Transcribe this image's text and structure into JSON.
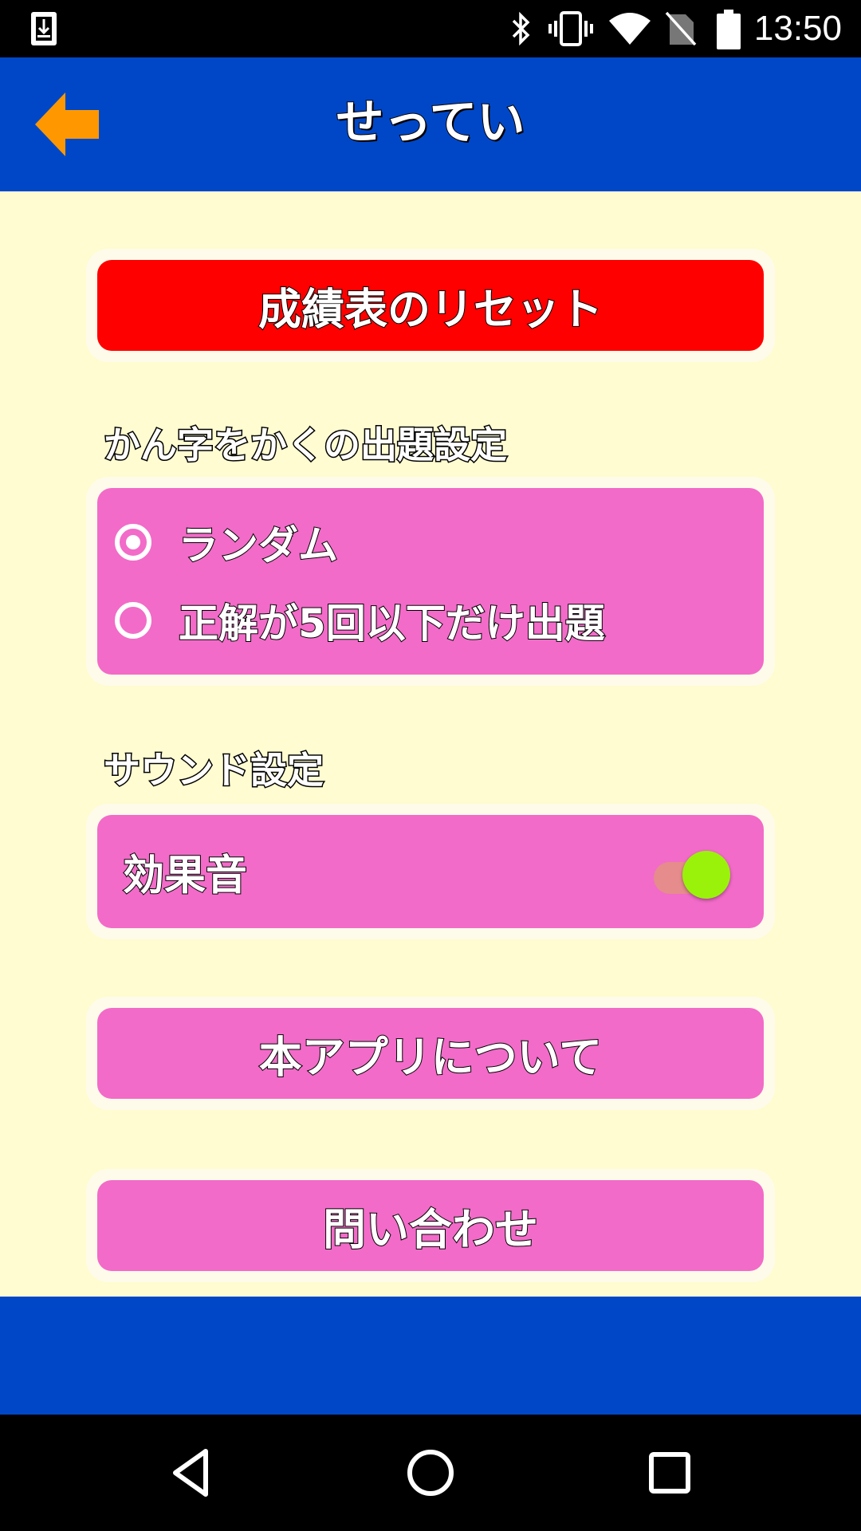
{
  "status_bar": {
    "time": "13:50",
    "icons": [
      "download-icon",
      "bluetooth-icon",
      "vibrate-icon",
      "wifi-icon",
      "no-sim-icon",
      "battery-icon"
    ]
  },
  "app_bar": {
    "title": "せってい",
    "back_icon": "back-arrow-icon"
  },
  "reset_button": {
    "label": "成績表のリセット"
  },
  "kanji_section": {
    "heading": "かん字をかくの出題設定",
    "options": [
      {
        "label": "ランダム",
        "selected": true
      },
      {
        "label": "正解が5回以下だけ出題",
        "selected": false
      }
    ]
  },
  "sound_section": {
    "heading": "サウンド設定",
    "switch_label": "効果音",
    "switch_on": true
  },
  "about_button": {
    "label": "本アプリについて"
  },
  "contact_button": {
    "label": "問い合わせ"
  },
  "nav_bar": {
    "icons": [
      "nav-back-icon",
      "nav-home-icon",
      "nav-recents-icon"
    ]
  },
  "colors": {
    "header": "#0047c8",
    "background": "#fefcd0",
    "reset": "#ff0000",
    "pink": "#f26bc8",
    "back_arrow": "#ff9800",
    "switch_thumb": "#9af20b"
  }
}
